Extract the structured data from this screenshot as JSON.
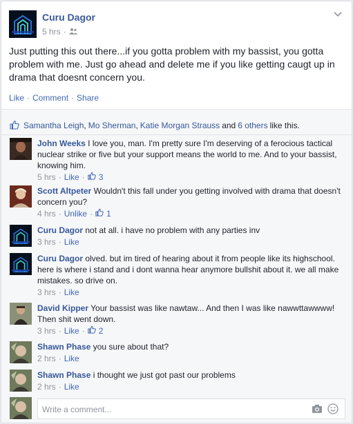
{
  "post": {
    "author": "Curu Dagor",
    "time": "5 hrs",
    "separator": "·",
    "privacy_icon": "friends-icon",
    "text": "Just putting this out there...if you gotta problem with my bassist, you gotta problem with me. Just go ahead and delete me if you like getting caugt up in drama that doesnt concern you.",
    "actions": {
      "like": "Like",
      "dot1": "·",
      "comment": "Comment",
      "dot2": "·",
      "share": "Share"
    }
  },
  "likes": {
    "icon": "thumbs-up-icon",
    "p1": "Samantha Leigh",
    "sep1": ",",
    "p2": "Mo Sherman",
    "sep2": ",",
    "p3": "Katie Morgan Strauss",
    "and": "and",
    "others": "6 others",
    "tail": "like this."
  },
  "comments": [
    {
      "name": "John Weeks",
      "text": "I love you, man. I'm pretty sure I'm deserving of a ferocious tactical nuclear strike or five but your support means the world to me. And to your bassist, knowing him.",
      "time": "5 hrs",
      "action": "Like",
      "likes": "3"
    },
    {
      "name": "Scott Altpeter",
      "text": "Wouldn't this fall under you getting involved with drama that doesn't concern you?",
      "time": "4 hrs",
      "action": "Unlike",
      "likes": "1"
    },
    {
      "name": "Curu Dagor",
      "text": "not at all. i have no problem with any parties inv",
      "time": "3 hrs",
      "action": "Like",
      "likes": ""
    },
    {
      "name": "Curu Dagor",
      "text": "olved. but im tired of hearing about it from people like its highschool. here is where i stand and i dont wanna hear anymore bullshit about it. we all make mistakes. so drive on.",
      "time": "3 hrs",
      "action": "Like",
      "likes": ""
    },
    {
      "name": "David Kipper",
      "text": "Your bassist was like nawtaw... And then I was like nawwttawwww! Then shit went down.",
      "time": "3 hrs",
      "action": "Like",
      "likes": "2"
    },
    {
      "name": "Shawn Phase",
      "text": "you sure about that?",
      "time": "2 hrs",
      "action": "Like",
      "likes": ""
    },
    {
      "name": "Shawn Phase",
      "text": "i thought we just got past our problems",
      "time": "2 hrs",
      "action": "Like",
      "likes": ""
    }
  ],
  "composer": {
    "placeholder": "Write a comment...",
    "camera_icon": "camera-icon",
    "emoji_icon": "emoji-icon"
  },
  "colors": {
    "link": "#365899",
    "meta": "#90949c",
    "bg": "#f6f7f9"
  }
}
